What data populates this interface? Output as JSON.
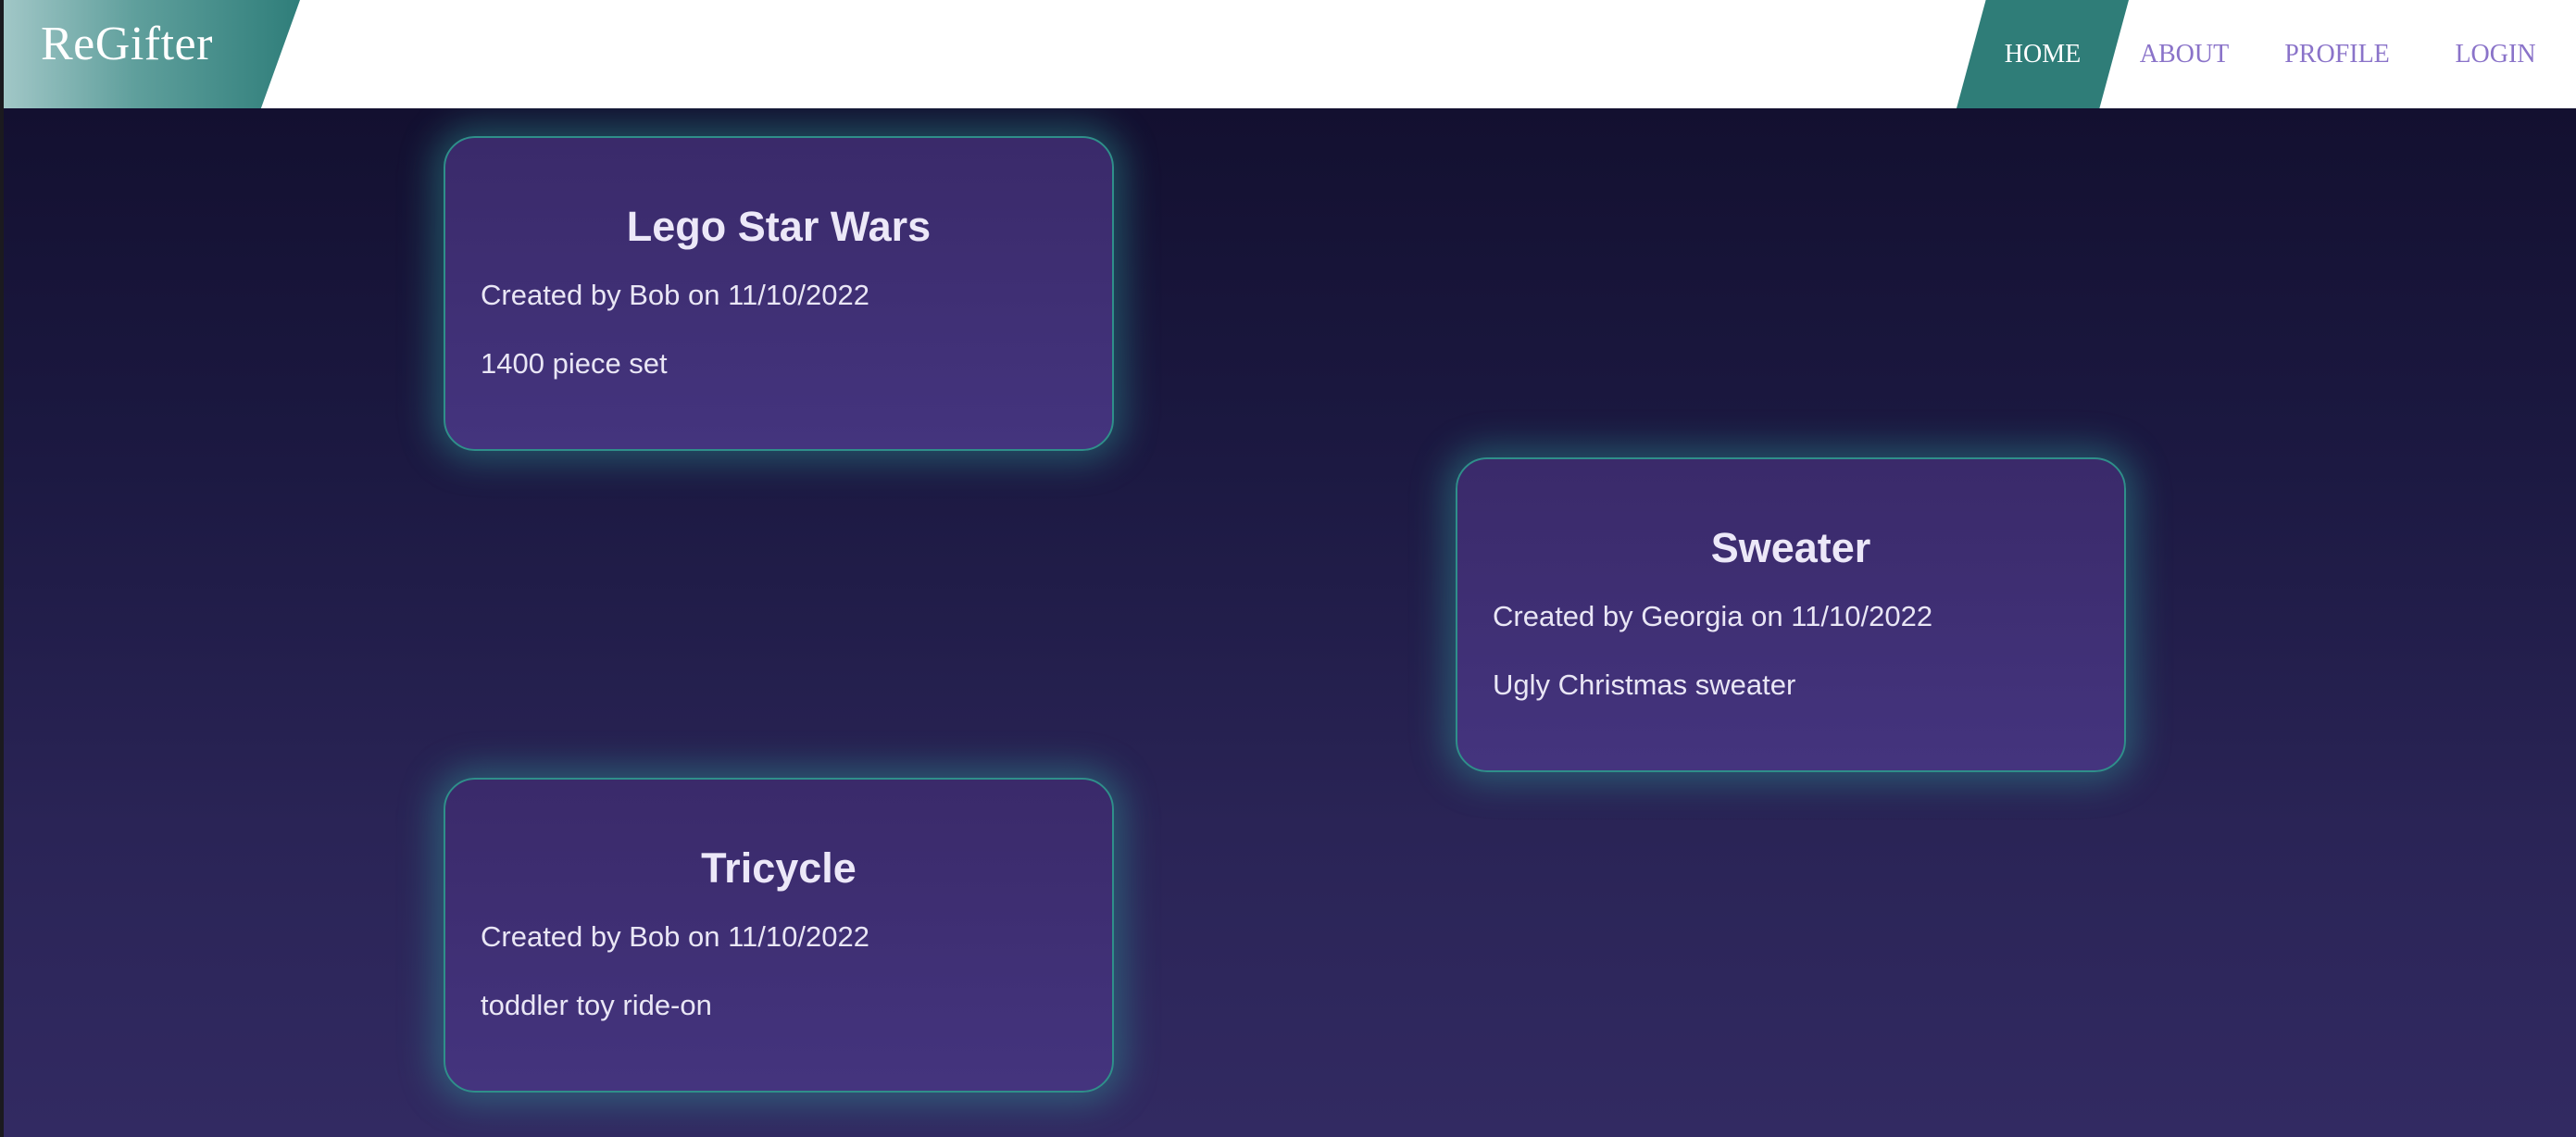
{
  "brand": "ReGifter",
  "nav": {
    "items": [
      {
        "label": "HOME",
        "active": true
      },
      {
        "label": "ABOUT"
      },
      {
        "label": "PROFILE"
      },
      {
        "label": "LOGIN"
      }
    ]
  },
  "colors": {
    "accent_teal": "#2f7d78",
    "nav_link": "#8a73c9",
    "card_bg": "#3e2f72",
    "page_bg_top": "#131030",
    "page_bg_bottom": "#322a62"
  },
  "gifts": [
    {
      "title": "Lego Star Wars",
      "meta": "Created by Bob on 11/10/2022",
      "description": "1400 piece set"
    },
    {
      "title": "Sweater",
      "meta": "Created by Georgia on 11/10/2022",
      "description": "Ugly Christmas sweater"
    },
    {
      "title": "Tricycle",
      "meta": "Created by Bob on 11/10/2022",
      "description": "toddler toy ride-on"
    }
  ]
}
